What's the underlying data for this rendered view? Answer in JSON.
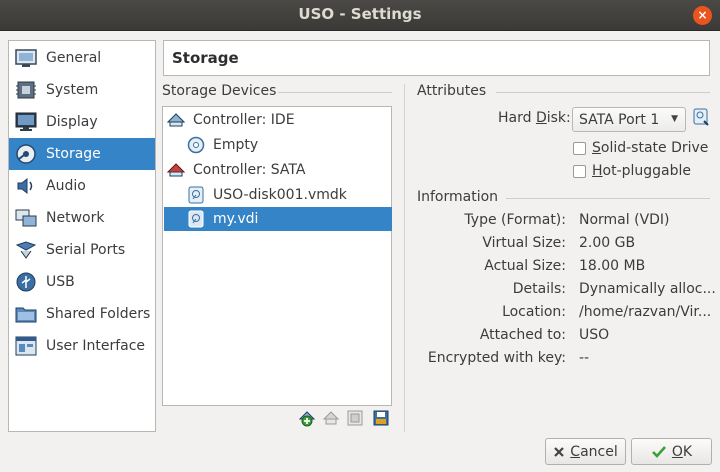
{
  "window": {
    "title": "USO - Settings",
    "close_glyph": "×"
  },
  "sidebar": {
    "items": [
      {
        "label": "General",
        "icon": "general-icon"
      },
      {
        "label": "System",
        "icon": "system-icon"
      },
      {
        "label": "Display",
        "icon": "display-icon"
      },
      {
        "label": "Storage",
        "icon": "storage-icon",
        "active": true
      },
      {
        "label": "Audio",
        "icon": "audio-icon"
      },
      {
        "label": "Network",
        "icon": "network-icon"
      },
      {
        "label": "Serial Ports",
        "icon": "serial-ports-icon"
      },
      {
        "label": "USB",
        "icon": "usb-icon"
      },
      {
        "label": "Shared Folders",
        "icon": "shared-folders-icon"
      },
      {
        "label": "User Interface",
        "icon": "user-interface-icon"
      }
    ]
  },
  "header": {
    "title": "Storage"
  },
  "storage_devices": {
    "title": "Storage Devices",
    "tree": [
      {
        "label": "Controller: IDE",
        "type": "controller",
        "icon": "ide-controller-icon"
      },
      {
        "label": "Empty",
        "type": "optical",
        "icon": "optical-disc-icon"
      },
      {
        "label": "Controller: SATA",
        "type": "controller",
        "icon": "sata-controller-icon"
      },
      {
        "label": "USO-disk001.vmdk",
        "type": "disk",
        "icon": "hard-disk-icon"
      },
      {
        "label": "my.vdi",
        "type": "disk",
        "icon": "hard-disk-icon",
        "selected": true
      }
    ],
    "toolbar": [
      "add-attachment-icon",
      "remove-attachment-icon",
      "add-controller-icon",
      "remove-controller-icon"
    ]
  },
  "attributes": {
    "title": "Attributes",
    "hard_disk_label_pre": "Hard ",
    "hard_disk_label_mnemonic": "D",
    "hard_disk_label_post": "isk:",
    "hard_disk_value": "SATA Port 1",
    "solid_state_mnemonic": "S",
    "solid_state_rest": "olid-state Drive",
    "solid_state_checked": false,
    "hot_pluggable_mnemonic": "H",
    "hot_pluggable_rest": "ot-pluggable",
    "hot_pluggable_checked": false
  },
  "information": {
    "title": "Information",
    "rows": [
      {
        "key": "Type (Format):",
        "value": "Normal (VDI)"
      },
      {
        "key": "Virtual Size:",
        "value": "2.00 GB"
      },
      {
        "key": "Actual Size:",
        "value": "18.00 MB"
      },
      {
        "key": "Details:",
        "value": "Dynamically alloc..."
      },
      {
        "key": "Location:",
        "value": "/home/razvan/Vir..."
      },
      {
        "key": "Attached to:",
        "value": "USO"
      },
      {
        "key": "Encrypted with key:",
        "value": "--"
      }
    ]
  },
  "buttons": {
    "cancel_mnemonic": "C",
    "cancel_rest": "ancel",
    "ok_mnemonic": "O",
    "ok_rest": "K"
  },
  "colors": {
    "selection": "#3584c8",
    "titlebar": "#3b3a37",
    "close": "#e9541f"
  }
}
